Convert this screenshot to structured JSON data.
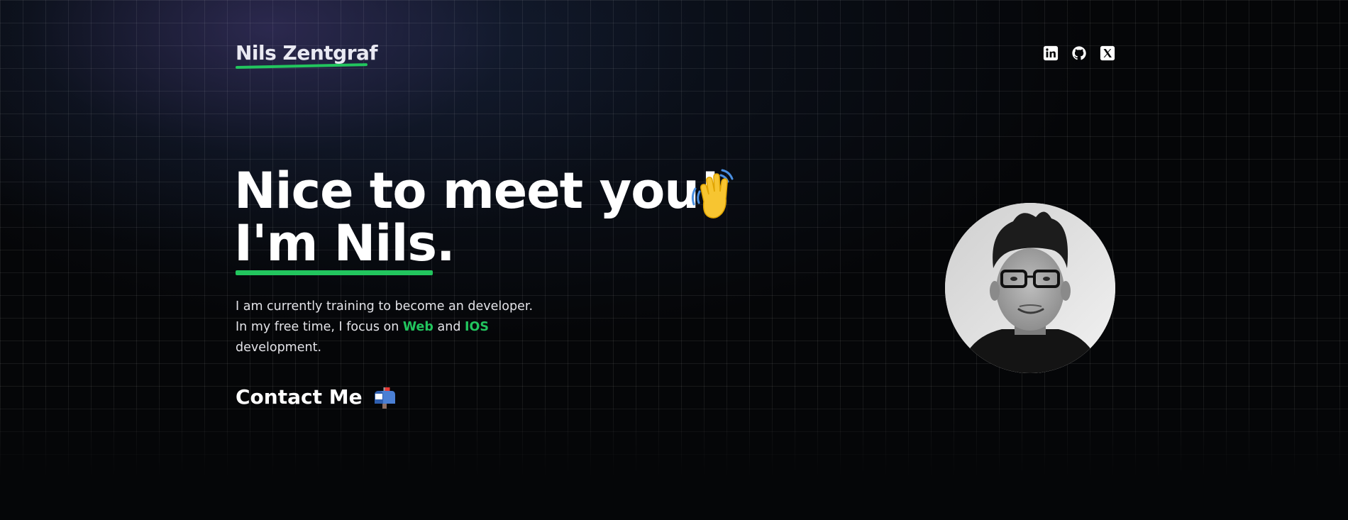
{
  "header": {
    "logo_text": "Nils Zentgraf",
    "social_links": [
      {
        "icon": "linkedin-icon"
      },
      {
        "icon": "github-icon"
      },
      {
        "icon": "x-twitter-icon"
      }
    ]
  },
  "hero": {
    "title_line1": "Nice to meet you!",
    "title_line2": "I'm Nils.",
    "wave_icon": "waving-hand-icon",
    "intro_line1": "I am currently training to become an developer.",
    "intro_line2_prefix": "In my free time, I focus on",
    "intro_highlight1": "Web",
    "intro_and": "and",
    "intro_highlight2": "IOS",
    "intro_line3": "development.",
    "contact_label": "Contact Me",
    "contact_icon": "mailbox-icon",
    "avatar_icon": "profile-photo"
  },
  "colors": {
    "accent": "#22c55e",
    "background": "#050608",
    "text": "#ffffff"
  }
}
